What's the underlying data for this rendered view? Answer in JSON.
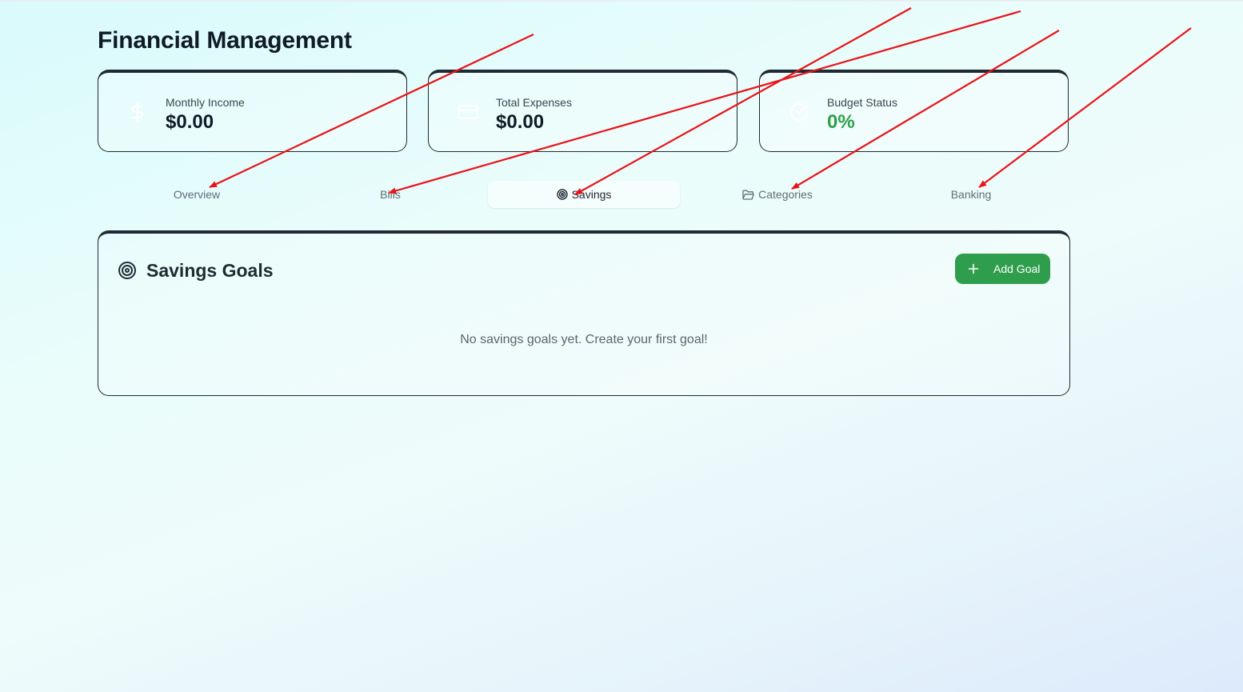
{
  "page": {
    "title": "Financial Management"
  },
  "cards": [
    {
      "label": "Monthly Income",
      "value": "$0.00",
      "icon": "dollar-icon"
    },
    {
      "label": "Total Expenses",
      "value": "$0.00",
      "icon": "credit-card-icon"
    },
    {
      "label": "Budget Status",
      "value": "0%",
      "icon": "check-circle-icon",
      "value_color": "#2e9e4a"
    }
  ],
  "tabs": [
    {
      "label": "Overview",
      "active": false
    },
    {
      "label": "Bills",
      "active": false
    },
    {
      "label": "Savings",
      "active": true,
      "icon": "target-icon"
    },
    {
      "label": "Categories",
      "active": false,
      "icon": "folder-icon"
    },
    {
      "label": "Banking",
      "active": false
    }
  ],
  "panel": {
    "title": "Savings Goals",
    "title_icon": "target-icon",
    "add_button_label": "Add Goal",
    "empty_message": "No savings goals yet. Create your first goal!"
  },
  "annotations": {
    "arrow_color": "#e8141a",
    "arrow_count": 5
  },
  "colors": {
    "accent_green": "#2f9e4c",
    "card_border": "#1f2a33"
  }
}
